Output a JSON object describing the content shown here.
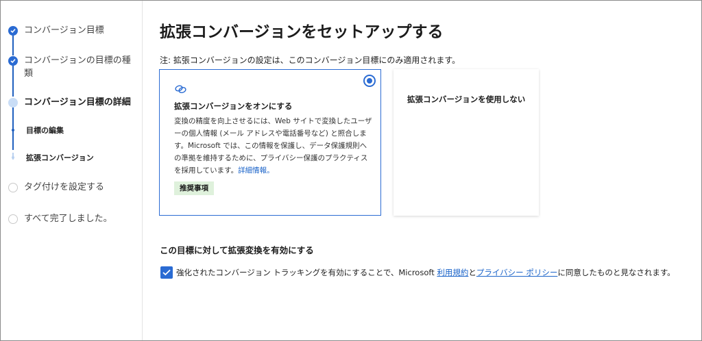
{
  "sidebar": {
    "steps": [
      {
        "label": "コンバージョン目標",
        "state": "done"
      },
      {
        "label": "コンバージョンの目標の種類",
        "state": "done"
      },
      {
        "label": "コンバージョン目標の詳細",
        "state": "current"
      },
      {
        "label": "目標の編集",
        "state": "sub-done"
      },
      {
        "label": "拡張コンバージョン",
        "state": "sub-current"
      },
      {
        "label": "タグ付けを設定する",
        "state": "pending"
      },
      {
        "label": "すべて完了しました。",
        "state": "pending"
      }
    ]
  },
  "main": {
    "title": "拡張コンバージョンをセットアップする",
    "note": "注: 拡張コンバージョンの設定は、このコンバージョン目標にのみ適用されます。",
    "option_on": {
      "icon": "link-icon",
      "selected": true,
      "title": "拡張コンバージョンをオンにする",
      "description": "変換の精度を向上させるには、Web サイトで変換したユーザーの個人情報 (メール アドレスや電話番号など) と照合します。Microsoft では、この情報を保護し、データ保護規則への準拠を維持するために、プライバシー保護のプラクティスを採用しています。",
      "learn_more": "詳細情報。",
      "badge": "推奨事項"
    },
    "option_off": {
      "selected": false,
      "title": "拡張コンバージョンを使用しない"
    },
    "section_heading": "この目標に対して拡張変換を有効にする",
    "consent": {
      "checked": true,
      "text_before": "強化されたコンバージョン トラッキングを有効にすることで、Microsoft ",
      "terms_link": "利用規約",
      "and": "と",
      "privacy_link": "プライバシー ポリシー",
      "text_after": "に同意したものと見なされます。"
    }
  },
  "colors": {
    "accent": "#2a6bd3",
    "badge_bg": "#dff1dc",
    "link": "#1a63c9"
  }
}
